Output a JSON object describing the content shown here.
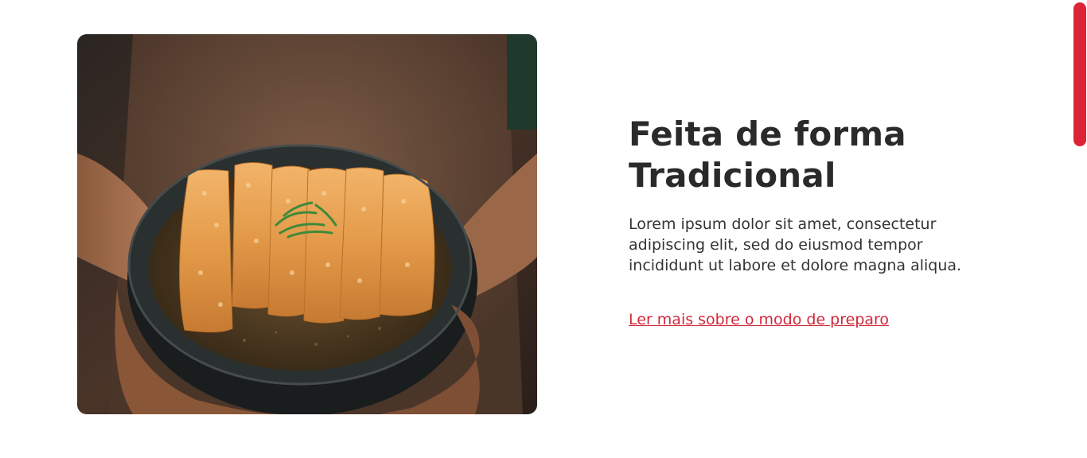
{
  "image": {
    "alt": "food-bowl-photo"
  },
  "content": {
    "title": "Feita de forma Tradicional",
    "description": "Lorem ipsum dolor sit amet, consectetur adipiscing elit, sed do eiusmod tempor incididunt ut labore et dolore magna aliqua.",
    "link_text": "Ler mais sobre o modo de preparo"
  },
  "colors": {
    "accent": "#dc2437",
    "title": "#2a2a2a",
    "text": "#333333"
  }
}
